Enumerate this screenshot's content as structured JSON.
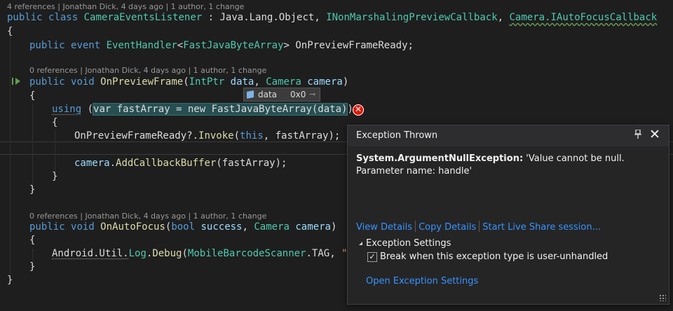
{
  "codelens": {
    "class_lens": "4 references | Jonathan Dick, 4 days ago | 1 author, 1 change",
    "method1_lens": "0 references | Jonathan Dick, 4 days ago | 1 author, 1 change",
    "method2_lens": "0 references | Jonathan Dick, 4 days ago | 1 author, 1 change"
  },
  "code": {
    "l1": {
      "kw1": "public",
      "kw2": "class",
      "name": "CameraEventsListener",
      "colon": " : ",
      "base1": "Java.Lang.Object",
      "comma1": ", ",
      "base2": "INonMarshalingPreviewCallback",
      "comma2": ", ",
      "base3": "Camera.IAutoFocusCallback"
    },
    "l2": "{",
    "l3": {
      "kw1": "public",
      "kw2": "event",
      "type": "EventHandler",
      "lt": "<",
      "targ": "FastJavaByteArray",
      "gt": "> OnPreviewFrameReady;"
    },
    "l4": {
      "kw1": "public",
      "kw2": "void",
      "name": "OnPreviewFrame",
      "open": "(",
      "t1": "IntPtr",
      "p1": "data",
      "c": ", ",
      "t2": "Camera",
      "p2": "camera",
      "close": ")"
    },
    "l5": "{",
    "l6": {
      "kw": "using",
      "open": " (",
      "hl": "var fastArray = new FastJavaByteArray(data)",
      "close": ")"
    },
    "l7": "{",
    "l8": {
      "name": "OnPreviewFrameReady",
      "q": "?.",
      "fn": "Invoke",
      "open": "(",
      "kw": "this",
      "rest": ", fastArray);"
    },
    "l9": {
      "obj": "camera.",
      "fn": "AddCallbackBuffer",
      "rest": "(fastArray);"
    },
    "l10": "}",
    "l11": "}",
    "l12": {
      "kw1": "public",
      "kw2": "void",
      "name": "OnAutoFocus",
      "open": "(",
      "t1": "bool",
      "p1": "success",
      "c": ", ",
      "t2": "Camera",
      "p2": "camera",
      "close": ")"
    },
    "l13": "{",
    "l14": {
      "ns": "Android.Util.",
      "cls": "Log",
      "dot": ".",
      "fn": "Debug",
      "open": "(",
      "t": "MobileBarcodeScanner",
      "prop": ".TAG, ",
      "str": "\"Au"
    },
    "l15": "}",
    "l16": "}"
  },
  "datatip": {
    "name": "data",
    "value": "0x0",
    "pin_glyph": "⊸"
  },
  "error_glyph": "✕",
  "popup": {
    "title": "Exception Thrown",
    "pin_glyph": "📌",
    "close_glyph": "✕",
    "exception_type": "System.ArgumentNullException:",
    "exception_message": " 'Value cannot be null.",
    "exception_detail": "Parameter name: handle'",
    "links": {
      "view_details": "View Details",
      "copy_details": "Copy Details",
      "live_share": "Start Live Share session..."
    },
    "settings_header": "Exception Settings",
    "checkbox_checked": "✓",
    "checkbox_label": "Break when this exception type is user-unhandled",
    "open_settings": "Open Exception Settings"
  },
  "colors": {
    "background": "#1e1e1e",
    "keyword": "#569cd6",
    "type": "#4ec9b0",
    "parameter": "#9cdcfe",
    "method": "#dcdcaa",
    "string": "#d69d85",
    "link": "#3794ff",
    "error": "#e51400"
  }
}
